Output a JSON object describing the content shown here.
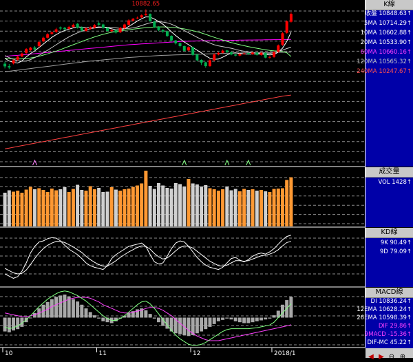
{
  "colors": {
    "up": "#ff0000",
    "down": "#00b050",
    "ma5": "#ffffff",
    "ma10": "#c8c8c8",
    "ma20": "#80ff80",
    "ma60": "#ff00ff",
    "ma120": "#a0a0a0",
    "ma240": "#ff4040",
    "vol_up": "#ff9933",
    "vol_down": "#d0d0d0",
    "panel_bg": "#0000a8"
  },
  "kline_panel": {
    "title": "K線",
    "peak_label": "10882.65",
    "rows": [
      {
        "label": "收盤",
        "value": "10848.63",
        "arrow": "↑",
        "color": "#ffffff"
      },
      {
        "label": "5MA",
        "value": "10714.29",
        "arrow": "↑",
        "color": "#ffffff"
      },
      {
        "label": "10MA",
        "value": "10602.88",
        "arrow": "↑",
        "color": "#ffffff"
      },
      {
        "label": "20MA",
        "value": "10533.90",
        "arrow": "↑",
        "color": "#ffffff"
      },
      {
        "label": "60MA",
        "value": "10660.16",
        "arrow": "↑",
        "color": "#ff40ff"
      },
      {
        "label": "120MA",
        "value": "10565.32",
        "arrow": "↑",
        "color": "#c8c8c8"
      },
      {
        "label": "240MA",
        "value": "10247.67",
        "arrow": "↑",
        "color": "#ff5050"
      }
    ]
  },
  "volume_panel": {
    "title": "成交量",
    "rows": [
      {
        "label": "VOL",
        "value": "1428",
        "arrow": "↑",
        "color": "#ffffff"
      }
    ]
  },
  "kd_panel": {
    "title": "KD線",
    "rows": [
      {
        "label": "9K",
        "value": "90.49",
        "arrow": "↑",
        "color": "#ffffff"
      },
      {
        "label": "9D",
        "value": "79.09",
        "arrow": "↑",
        "color": "#ffffff"
      }
    ]
  },
  "macd_panel": {
    "title": "MACD線",
    "rows": [
      {
        "label": "DI",
        "value": "10836.24",
        "arrow": "↑",
        "color": "#ffffff"
      },
      {
        "label": "12EMA",
        "value": "10628.24",
        "arrow": "↑",
        "color": "#ffffff"
      },
      {
        "label": "26EMA",
        "value": "10598.39",
        "arrow": "↑",
        "color": "#ffffff"
      },
      {
        "label": "DIF",
        "value": "29.86",
        "arrow": "↑",
        "color": "#ff40ff"
      },
      {
        "label": "9MACD",
        "value": "-15.36",
        "arrow": "↑",
        "color": "#ff40ff"
      },
      {
        "label": "DIF-MC",
        "value": "45.22",
        "arrow": "↑",
        "color": "#ffffff"
      }
    ]
  },
  "x_axis": {
    "labels": [
      "10",
      "11",
      "12",
      "2018/1"
    ]
  },
  "nav": {
    "icons": [
      "left-arrow-icon",
      "right-arrow-icon",
      "zoom-out-icon",
      "zoom-in-icon"
    ]
  },
  "chart_data": {
    "type": "candlestick",
    "price_range": [
      9750,
      10900
    ],
    "dates": [
      "2017/10",
      "2017/10",
      "2017/10",
      "2017/10",
      "2017/10",
      "2017/10",
      "2017/10",
      "2017/10",
      "2017/10",
      "2017/10",
      "2017/10",
      "2017/10",
      "2017/10",
      "2017/10",
      "2017/10",
      "2017/10",
      "2017/10",
      "2017/10",
      "2017/10",
      "2017/10",
      "2017/10",
      "2017/10",
      "2017/11",
      "2017/11",
      "2017/11",
      "2017/11",
      "2017/11",
      "2017/11",
      "2017/11",
      "2017/11",
      "2017/11",
      "2017/11",
      "2017/11",
      "2017/11",
      "2017/11",
      "2017/11",
      "2017/11",
      "2017/11",
      "2017/11",
      "2017/11",
      "2017/11",
      "2017/11",
      "2017/11",
      "2017/11",
      "2017/12",
      "2017/12",
      "2017/12",
      "2017/12",
      "2017/12",
      "2017/12",
      "2017/12",
      "2017/12",
      "2017/12",
      "2017/12",
      "2017/12",
      "2017/12",
      "2017/12",
      "2017/12",
      "2017/12",
      "2017/12",
      "2017/12",
      "2017/12",
      "2017/12",
      "2018/1",
      "2018/1",
      "2018/1",
      "2018/1",
      "2018/1"
    ],
    "close": [
      10460,
      10452,
      10505,
      10532,
      10555,
      10588,
      10598,
      10585,
      10640,
      10672,
      10698,
      10712,
      10734,
      10740,
      10735,
      10752,
      10768,
      10746,
      10724,
      10742,
      10748,
      10766,
      10768,
      10744,
      10722,
      10728,
      10710,
      10745,
      10770,
      10800,
      10812,
      10820,
      10838,
      10848,
      10795,
      10750,
      10728,
      10718,
      10685,
      10652,
      10630,
      10610,
      10575,
      10602,
      10545,
      10505,
      10488,
      10462,
      10505,
      10548,
      10560,
      10576,
      10565,
      10548,
      10540,
      10552,
      10556,
      10550,
      10562,
      10545,
      10560,
      10525,
      10530,
      10565,
      10615,
      10705,
      10793,
      10848
    ],
    "open": [
      10480,
      10462,
      10482,
      10510,
      10533,
      10560,
      10580,
      10600,
      10610,
      10645,
      10672,
      10700,
      10715,
      10748,
      10745,
      10738,
      10752,
      10775,
      10750,
      10722,
      10738,
      10746,
      10778,
      10770,
      10745,
      10720,
      10728,
      10712,
      10742,
      10768,
      10798,
      10816,
      10822,
      10840,
      10848,
      10792,
      10752,
      10728,
      10720,
      10686,
      10652,
      10632,
      10610,
      10578,
      10602,
      10548,
      10508,
      10490,
      10462,
      10505,
      10548,
      10560,
      10578,
      10565,
      10548,
      10540,
      10552,
      10558,
      10550,
      10562,
      10545,
      10560,
      10525,
      10530,
      10568,
      10620,
      10708,
      10790
    ],
    "high": [
      10495,
      10478,
      10512,
      10540,
      10562,
      10595,
      10605,
      10610,
      10648,
      10680,
      10705,
      10720,
      10745,
      10755,
      10752,
      10760,
      10776,
      10780,
      10756,
      10748,
      10756,
      10772,
      10790,
      10776,
      10750,
      10735,
      10736,
      10752,
      10776,
      10808,
      10818,
      10828,
      10845,
      10882,
      10852,
      10798,
      10758,
      10736,
      10724,
      10690,
      10656,
      10636,
      10614,
      10608,
      10606,
      10552,
      10512,
      10495,
      10512,
      10556,
      10566,
      10584,
      10582,
      10570,
      10552,
      10558,
      10562,
      10562,
      10568,
      10566,
      10566,
      10564,
      10536,
      10572,
      10622,
      10712,
      10800,
      10860
    ],
    "low": [
      10445,
      10440,
      10475,
      10502,
      10528,
      10552,
      10574,
      10578,
      10602,
      10638,
      10666,
      10694,
      10708,
      10728,
      10726,
      10730,
      10746,
      10740,
      10718,
      10716,
      10732,
      10740,
      10760,
      10738,
      10716,
      10714,
      10702,
      10706,
      10736,
      10762,
      10792,
      10810,
      10818,
      10834,
      10790,
      10744,
      10720,
      10708,
      10678,
      10644,
      10622,
      10600,
      10568,
      10572,
      10538,
      10498,
      10470,
      10450,
      10458,
      10500,
      10542,
      10556,
      10558,
      10542,
      10534,
      10534,
      10546,
      10546,
      10546,
      10540,
      10540,
      10520,
      10518,
      10524,
      10562,
      10612,
      10702,
      10784
    ],
    "ma5": [
      10520,
      10500,
      10490,
      10485,
      10500,
      10530,
      10555,
      10575,
      10600,
      10625,
      10650,
      10675,
      10695,
      10712,
      10725,
      10735,
      10745,
      10752,
      10750,
      10746,
      10745,
      10748,
      10752,
      10750,
      10745,
      10738,
      10730,
      10730,
      10738,
      10755,
      10775,
      10795,
      10812,
      10826,
      10825,
      10810,
      10792,
      10772,
      10745,
      10715,
      10688,
      10664,
      10640,
      10620,
      10600,
      10580,
      10560,
      10538,
      10520,
      10512,
      10515,
      10528,
      10545,
      10558,
      10560,
      10555,
      10552,
      10550,
      10552,
      10552,
      10552,
      10548,
      10545,
      10548,
      10565,
      10595,
      10645,
      10714
    ],
    "ma10": [
      10540,
      10525,
      10512,
      10502,
      10498,
      10500,
      10510,
      10525,
      10542,
      10560,
      10580,
      10600,
      10620,
      10640,
      10660,
      10678,
      10694,
      10708,
      10720,
      10730,
      10738,
      10744,
      10748,
      10750,
      10750,
      10748,
      10745,
      10742,
      10740,
      10741,
      10745,
      10752,
      10762,
      10773,
      10782,
      10788,
      10790,
      10788,
      10782,
      10772,
      10758,
      10742,
      10725,
      10708,
      10692,
      10675,
      10660,
      10645,
      10632,
      10620,
      10612,
      10606,
      10600,
      10594,
      10586,
      10578,
      10572,
      10566,
      10562,
      10558,
      10556,
      10555,
      10556,
      10560,
      10570,
      10580,
      10592,
      10602
    ],
    "ma20": [
      10520,
      10518,
      10516,
      10515,
      10516,
      10518,
      10522,
      10528,
      10535,
      10544,
      10553,
      10563,
      10573,
      10584,
      10596,
      10608,
      10620,
      10632,
      10644,
      10656,
      10667,
      10678,
      10688,
      10697,
      10705,
      10712,
      10718,
      10723,
      10727,
      10731,
      10735,
      10739,
      10743,
      10746,
      10749,
      10751,
      10752,
      10752,
      10751,
      10749,
      10746,
      10742,
      10737,
      10731,
      10724,
      10716,
      10707,
      10697,
      10686,
      10675,
      10665,
      10655,
      10645,
      10636,
      10628,
      10620,
      10613,
      10606,
      10600,
      10594,
      10588,
      10583,
      10578,
      10575,
      10573,
      10570,
      10560,
      10533
    ],
    "ma60": [
      10535,
      10537,
      10540,
      10542,
      10545,
      10548,
      10551,
      10554,
      10557,
      10560,
      10563,
      10566,
      10569,
      10572,
      10575,
      10578,
      10581,
      10584,
      10587,
      10590,
      10593,
      10596,
      10599,
      10602,
      10605,
      10608,
      10611,
      10614,
      10617,
      10620,
      10622,
      10624,
      10626,
      10628,
      10630,
      10632,
      10634,
      10636,
      10638,
      10640,
      10642,
      10644,
      10645,
      10646,
      10647,
      10648,
      10649,
      10650,
      10650,
      10651,
      10651,
      10652,
      10652,
      10653,
      10653,
      10654,
      10654,
      10655,
      10655,
      10656,
      10656,
      10657,
      10657,
      10658,
      10658,
      10659,
      10659,
      10660
    ],
    "ma120": [
      10420,
      10424,
      10428,
      10432,
      10436,
      10440,
      10444,
      10448,
      10452,
      10456,
      10460,
      10464,
      10468,
      10472,
      10476,
      10480,
      10484,
      10488,
      10492,
      10496,
      10499,
      10502,
      10505,
      10508,
      10511,
      10514,
      10517,
      10520,
      10523,
      10526,
      10528,
      10530,
      10532,
      10534,
      10536,
      10538,
      10540,
      10542,
      10543,
      10544,
      10545,
      10546,
      10547,
      10548,
      10549,
      10550,
      10551,
      10552,
      10553,
      10554,
      10555,
      10556,
      10557,
      10558,
      10559,
      10559,
      10560,
      10560,
      10561,
      10561,
      10562,
      10562,
      10563,
      10563,
      10564,
      10564,
      10565,
      10565
    ],
    "ma240": [
      9850,
      9856,
      9862,
      9868,
      9874,
      9880,
      9886,
      9892,
      9898,
      9904,
      9910,
      9916,
      9922,
      9928,
      9934,
      9940,
      9946,
      9952,
      9958,
      9964,
      9970,
      9976,
      9982,
      9988,
      9994,
      10000,
      10006,
      10012,
      10018,
      10024,
      10030,
      10036,
      10042,
      10048,
      10054,
      10060,
      10066,
      10072,
      10078,
      10084,
      10090,
      10096,
      10102,
      10108,
      10114,
      10120,
      10126,
      10132,
      10138,
      10144,
      10150,
      10156,
      10162,
      10168,
      10174,
      10180,
      10186,
      10192,
      10198,
      10204,
      10210,
      10216,
      10222,
      10228,
      10234,
      10240,
      10244,
      10248
    ],
    "volume": [
      980,
      1050,
      1010,
      1040,
      980,
      1070,
      1150,
      1080,
      1110,
      1060,
      1000,
      1100,
      1050,
      1080,
      1140,
      1000,
      1090,
      1210,
      1060,
      1040,
      1170,
      1080,
      1120,
      1000,
      1010,
      1140,
      1070,
      1040,
      1080,
      1100,
      1150,
      1190,
      1250,
      1620,
      1180,
      1090,
      1260,
      1190,
      1120,
      1100,
      1260,
      1230,
      1160,
      1380,
      1250,
      1220,
      1160,
      1200,
      1110,
      1080,
      1040,
      1080,
      1160,
      1050,
      1090,
      1020,
      1090,
      1060,
      1080,
      1040,
      1060,
      1020,
      1000,
      1090,
      1100,
      1110,
      1350,
      1428
    ],
    "volume_range": [
      0,
      1700
    ],
    "k": [
      20,
      16,
      12,
      15,
      25,
      40,
      58,
      70,
      78,
      80,
      84,
      86,
      85,
      80,
      72,
      65,
      60,
      55,
      48,
      40,
      35,
      32,
      30,
      28,
      35,
      48,
      55,
      60,
      65,
      70,
      72,
      74,
      76,
      70,
      55,
      42,
      38,
      40,
      52,
      66,
      76,
      80,
      78,
      70,
      60,
      50,
      42,
      36,
      32,
      30,
      28,
      32,
      40,
      48,
      50,
      45,
      42,
      46,
      52,
      56,
      58,
      56,
      60,
      66,
      74,
      82,
      88,
      90.49
    ],
    "d": [
      30,
      26,
      22,
      20,
      21,
      27,
      37,
      48,
      58,
      66,
      72,
      76,
      79,
      79,
      77,
      73,
      69,
      64,
      59,
      52,
      46,
      41,
      37,
      34,
      34,
      39,
      44,
      50,
      55,
      60,
      64,
      68,
      71,
      70,
      65,
      57,
      51,
      47,
      49,
      55,
      62,
      68,
      71,
      70,
      67,
      61,
      55,
      49,
      43,
      39,
      35,
      34,
      36,
      40,
      44,
      44,
      43,
      44,
      47,
      50,
      53,
      54,
      56,
      59,
      64,
      71,
      77,
      79.09
    ],
    "kd_range": [
      0,
      100
    ],
    "macd_hist": [
      -30,
      -32,
      -28,
      -25,
      -20,
      -10,
      0,
      10,
      20,
      28,
      34,
      40,
      45,
      48,
      50,
      46,
      40,
      35,
      28,
      20,
      12,
      5,
      -2,
      -8,
      -10,
      -12,
      -8,
      -2,
      4,
      10,
      14,
      18,
      20,
      16,
      8,
      -2,
      -10,
      -18,
      -24,
      -30,
      -34,
      -36,
      -38,
      -40,
      -38,
      -34,
      -30,
      -25,
      -20,
      -14,
      -8,
      -5,
      -2,
      -4,
      -8,
      -10,
      -12,
      -12,
      -10,
      -8,
      -6,
      -4,
      -2,
      5,
      15,
      28,
      38,
      45.22
    ],
    "dif": [
      -20,
      -24,
      -22,
      -18,
      -12,
      -5,
      4,
      14,
      24,
      32,
      40,
      46,
      52,
      56,
      58,
      56,
      52,
      48,
      42,
      36,
      28,
      20,
      12,
      4,
      -2,
      -6,
      -6,
      -2,
      4,
      12,
      20,
      28,
      34,
      36,
      30,
      20,
      8,
      -4,
      -16,
      -28,
      -38,
      -46,
      -52,
      -58,
      -60,
      -60,
      -58,
      -54,
      -48,
      -42,
      -36,
      -30,
      -26,
      -24,
      -24,
      -24,
      -24,
      -24,
      -23,
      -22,
      -20,
      -18,
      -16,
      -10,
      0,
      10,
      20,
      29.86
    ],
    "macd9": [
      10,
      8,
      6,
      4,
      2,
      2,
      4,
      6,
      10,
      14,
      18,
      24,
      28,
      32,
      36,
      40,
      42,
      44,
      44,
      44,
      42,
      38,
      34,
      28,
      24,
      20,
      16,
      12,
      10,
      10,
      12,
      14,
      16,
      20,
      22,
      22,
      20,
      16,
      10,
      4,
      -4,
      -12,
      -20,
      -28,
      -34,
      -40,
      -44,
      -48,
      -50,
      -50,
      -50,
      -48,
      -46,
      -44,
      -42,
      -40,
      -38,
      -36,
      -34,
      -32,
      -30,
      -28,
      -26,
      -24,
      -22,
      -20,
      -18,
      -15.36
    ],
    "macd_range": [
      -62,
      62
    ],
    "ticks": [
      {
        "label": "10",
        "index": 0
      },
      {
        "label": "11",
        "index": 22
      },
      {
        "label": "12",
        "index": 44
      },
      {
        "label": "2018/1",
        "index": 63
      }
    ],
    "kd_triangles": [
      7,
      42,
      52,
      57
    ]
  }
}
